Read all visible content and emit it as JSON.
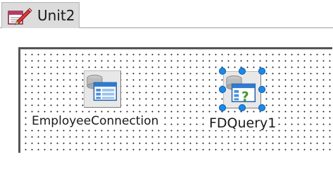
{
  "tab": {
    "label": "Unit2",
    "icon": "unit-file-edit-icon"
  },
  "designer": {
    "components": [
      {
        "name": "EmployeeConnection",
        "icon": "database-connection-icon",
        "selected": false
      },
      {
        "name": "FDQuery1",
        "icon": "database-query-icon",
        "selected": true
      }
    ],
    "selection_color": "#1e88e5",
    "grid_dot_color": "#222222"
  }
}
